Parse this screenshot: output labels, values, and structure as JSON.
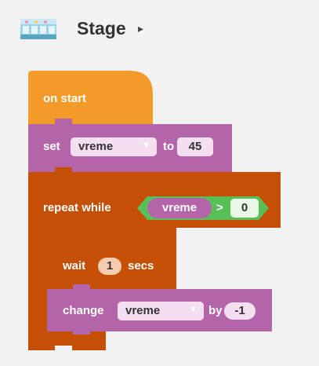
{
  "stage": {
    "title": "Stage",
    "arrow": "▸"
  },
  "blocks": {
    "on_start": "on start",
    "set": {
      "label": "set",
      "variable": "vreme",
      "to_label": "to",
      "value": "45"
    },
    "repeat_while": {
      "label": "repeat while",
      "variable": "vreme",
      "operator": ">",
      "compare_value": "0"
    },
    "wait": {
      "label": "wait",
      "value": "1",
      "unit": "secs"
    },
    "change": {
      "label": "change",
      "variable": "vreme",
      "by_label": "by",
      "value": "-1"
    }
  },
  "colors": {
    "event_orange": "#f29b29",
    "variable_purple": "#b464a8",
    "loop_brown": "#c55005",
    "boolean_green": "#59c059",
    "field_pink": "#f3dff0",
    "number_peach": "#f6ccae"
  }
}
